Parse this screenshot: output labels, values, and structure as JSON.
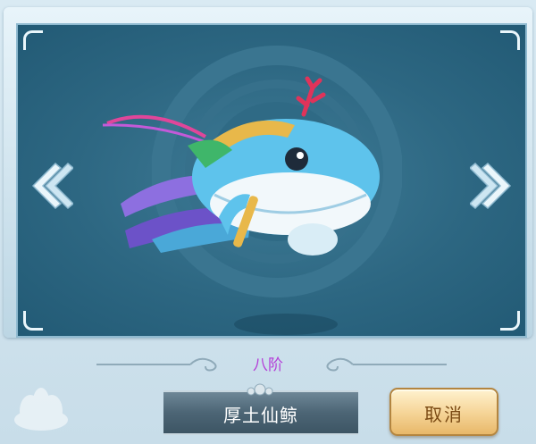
{
  "pet": {
    "rank": "八阶",
    "name": "厚土仙鲸"
  },
  "buttons": {
    "cancel_label": "取消",
    "prev_icon": "double-chevron-left-icon",
    "next_icon": "double-chevron-right-icon"
  },
  "colors": {
    "rank_text": "#b43ed8",
    "viewport_bg": "#2d6782",
    "button_gold": "#f6d69a"
  }
}
